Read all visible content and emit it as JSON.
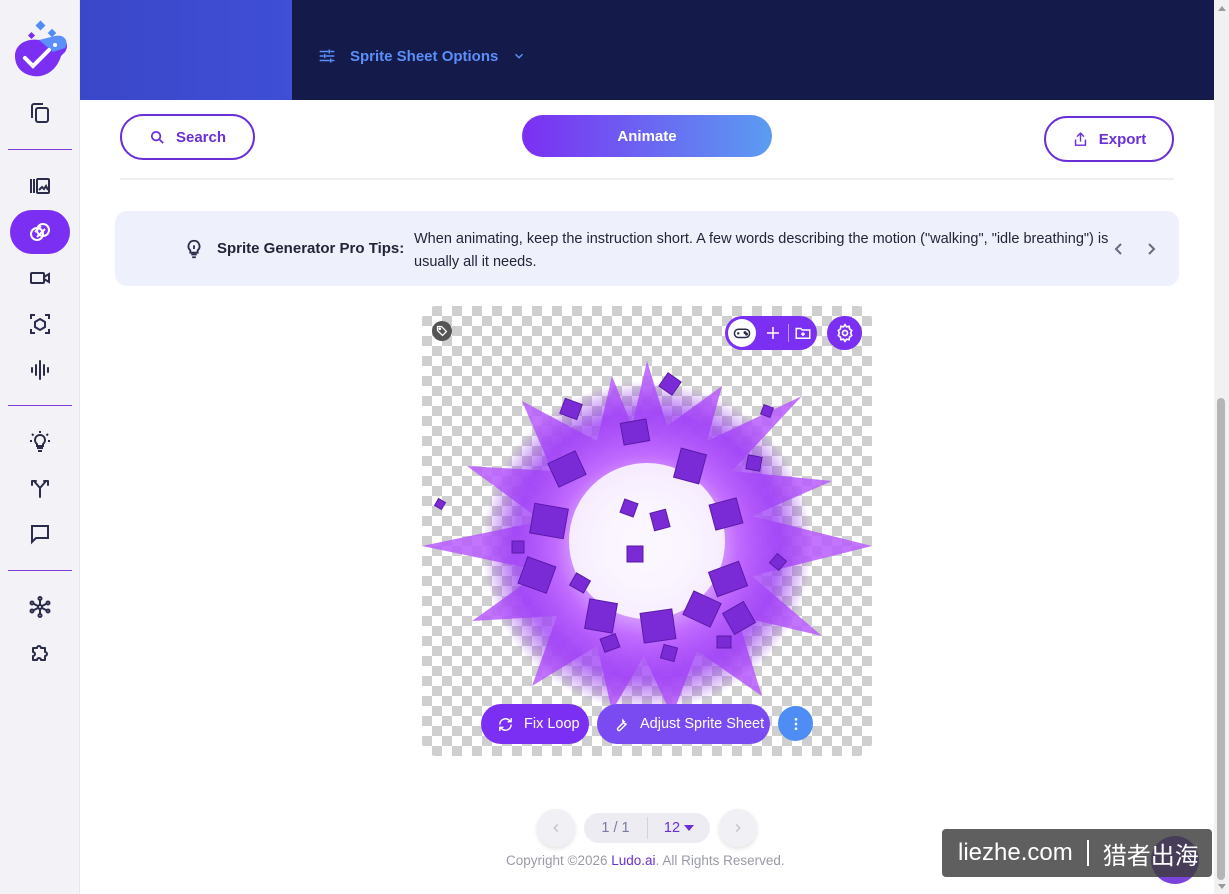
{
  "header": {
    "options_label": "Sprite Sheet Options"
  },
  "toolbar": {
    "search_label": "Search",
    "animate_label": "Animate",
    "export_label": "Export"
  },
  "tips": {
    "title": "Sprite Generator Pro Tips:",
    "text": "When animating, keep the instruction short. A few words describing the motion (\"walking\", \"idle breathing\") is usually all it needs."
  },
  "preview": {
    "fix_loop_label": "Fix Loop",
    "adjust_label": "Adjust Sprite Sheet"
  },
  "pagination": {
    "pages": "1 / 1",
    "page_size": "12"
  },
  "footer": {
    "copyright_prefix": "Copyright ©2026 ",
    "brand": "Ludo.ai",
    "copyright_suffix": ". All Rights Reserved."
  },
  "watermark": {
    "left": "liezhe.com",
    "right": "猎者出海"
  },
  "colors": {
    "accent": "#7b2ff2",
    "header_bg": "#141a4a",
    "link_blue": "#5b8ff9",
    "tips_bg": "#eef0fb"
  },
  "icons": {
    "rail": [
      "copy-icon",
      "gallery-icon",
      "sprite-icon",
      "video-icon",
      "cube-icon",
      "audio-icon",
      "idea-icon",
      "fork-icon",
      "chat-icon",
      "network-icon",
      "puzzle-icon"
    ],
    "card": [
      "tag-icon",
      "gamepad-icon",
      "plus-icon",
      "folder-add-icon",
      "gear-icon",
      "loop-icon",
      "wrench-icon",
      "more-vertical-icon"
    ]
  }
}
